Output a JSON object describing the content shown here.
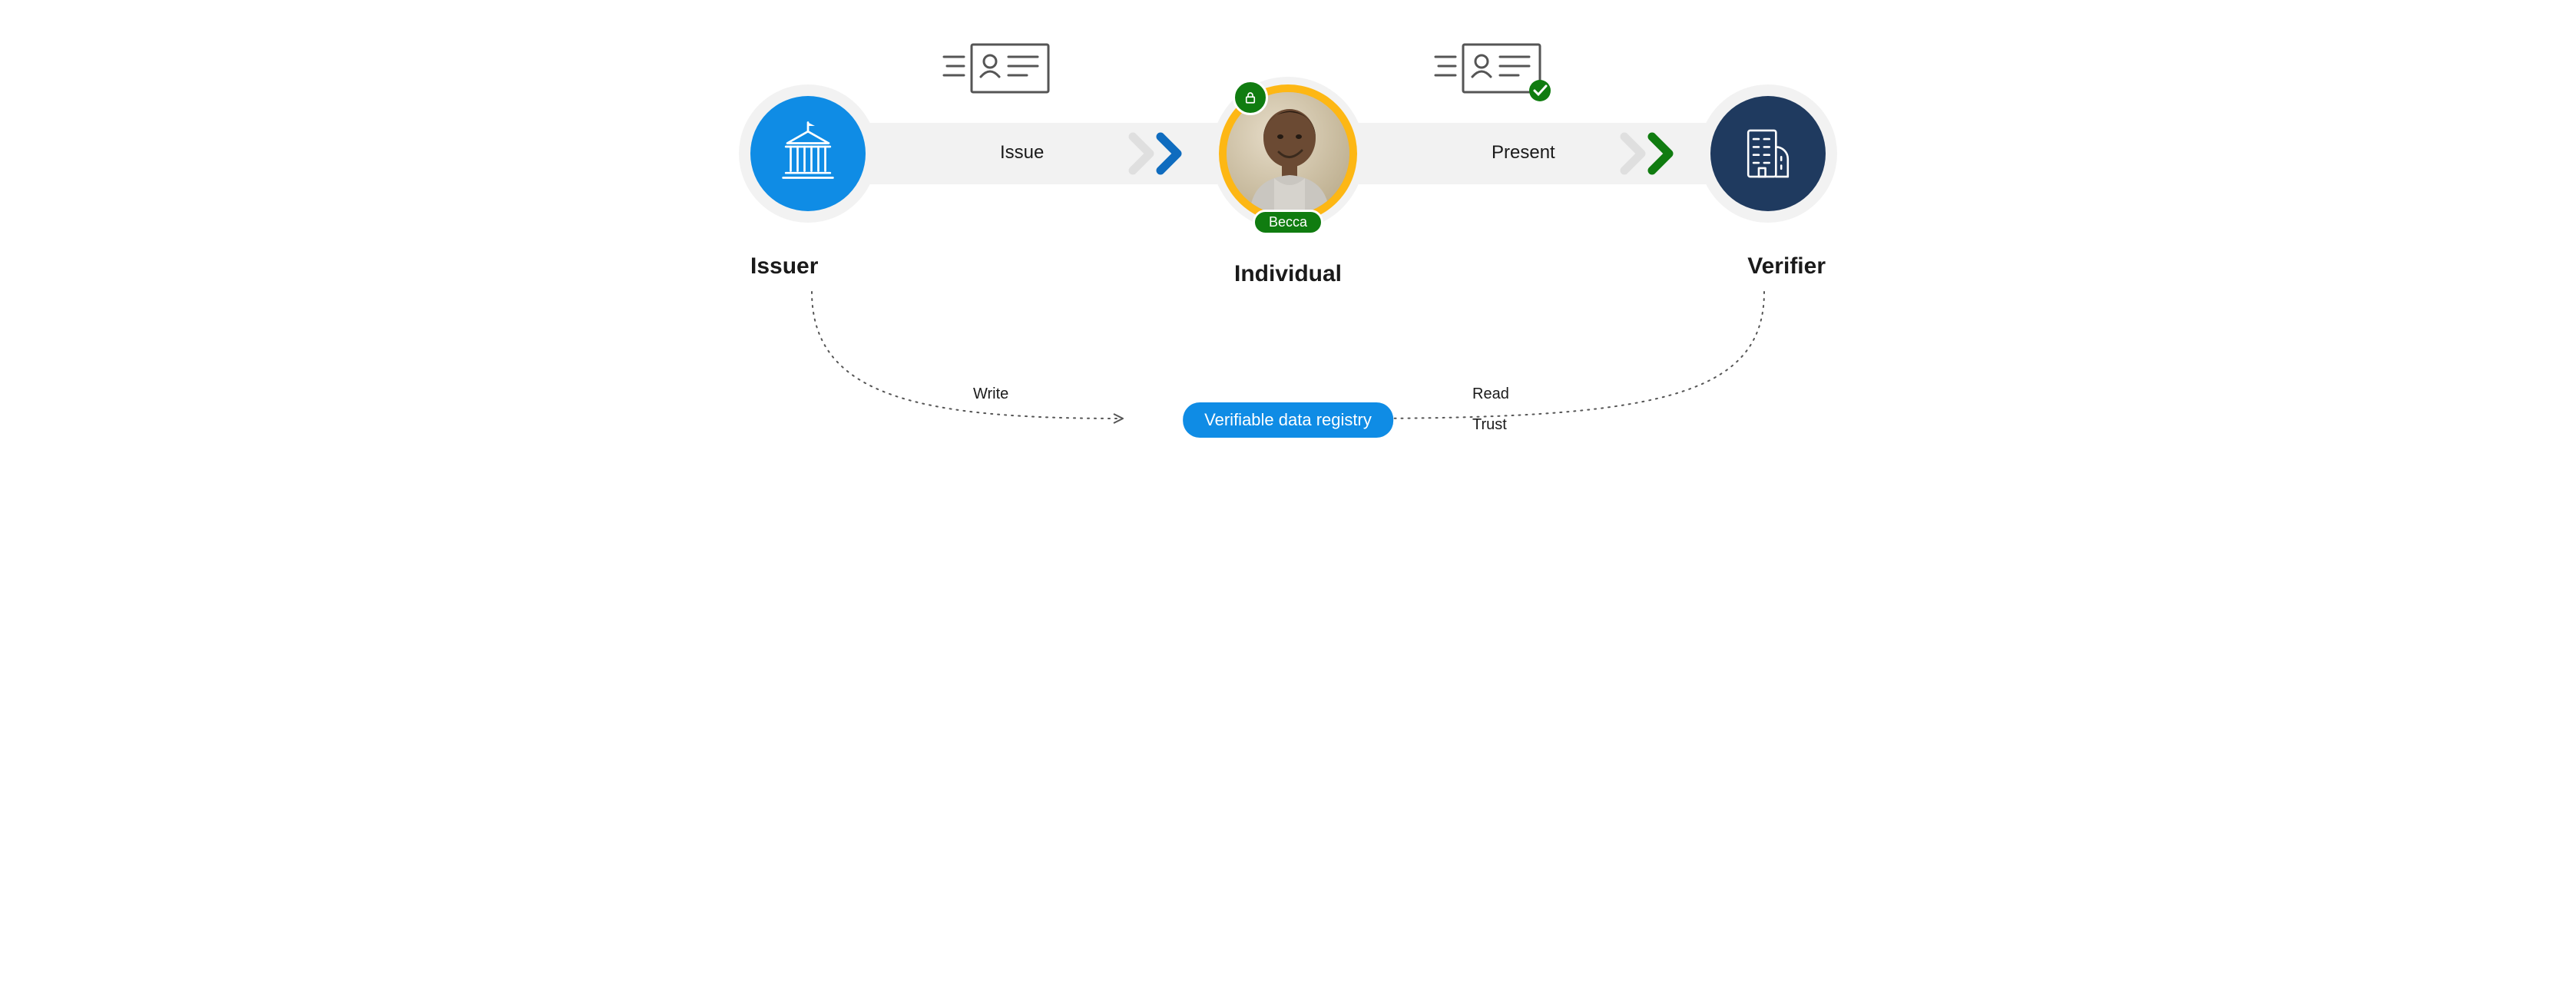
{
  "roles": {
    "issuer": "Issuer",
    "individual": "Individual",
    "verifier": "Verifier"
  },
  "steps": {
    "issue": "Issue",
    "present": "Present"
  },
  "person": {
    "name": "Becca"
  },
  "registry": {
    "label": "Verifiable data registry",
    "write": "Write",
    "read": "Read",
    "trust": "Trust"
  },
  "colors": {
    "issuer_bg": "#0f8ce5",
    "verifier_bg": "#1f3a5f",
    "accent_green": "#107c10",
    "accent_yellow": "#fdb714",
    "flow_grey": "#f2f2f2"
  }
}
